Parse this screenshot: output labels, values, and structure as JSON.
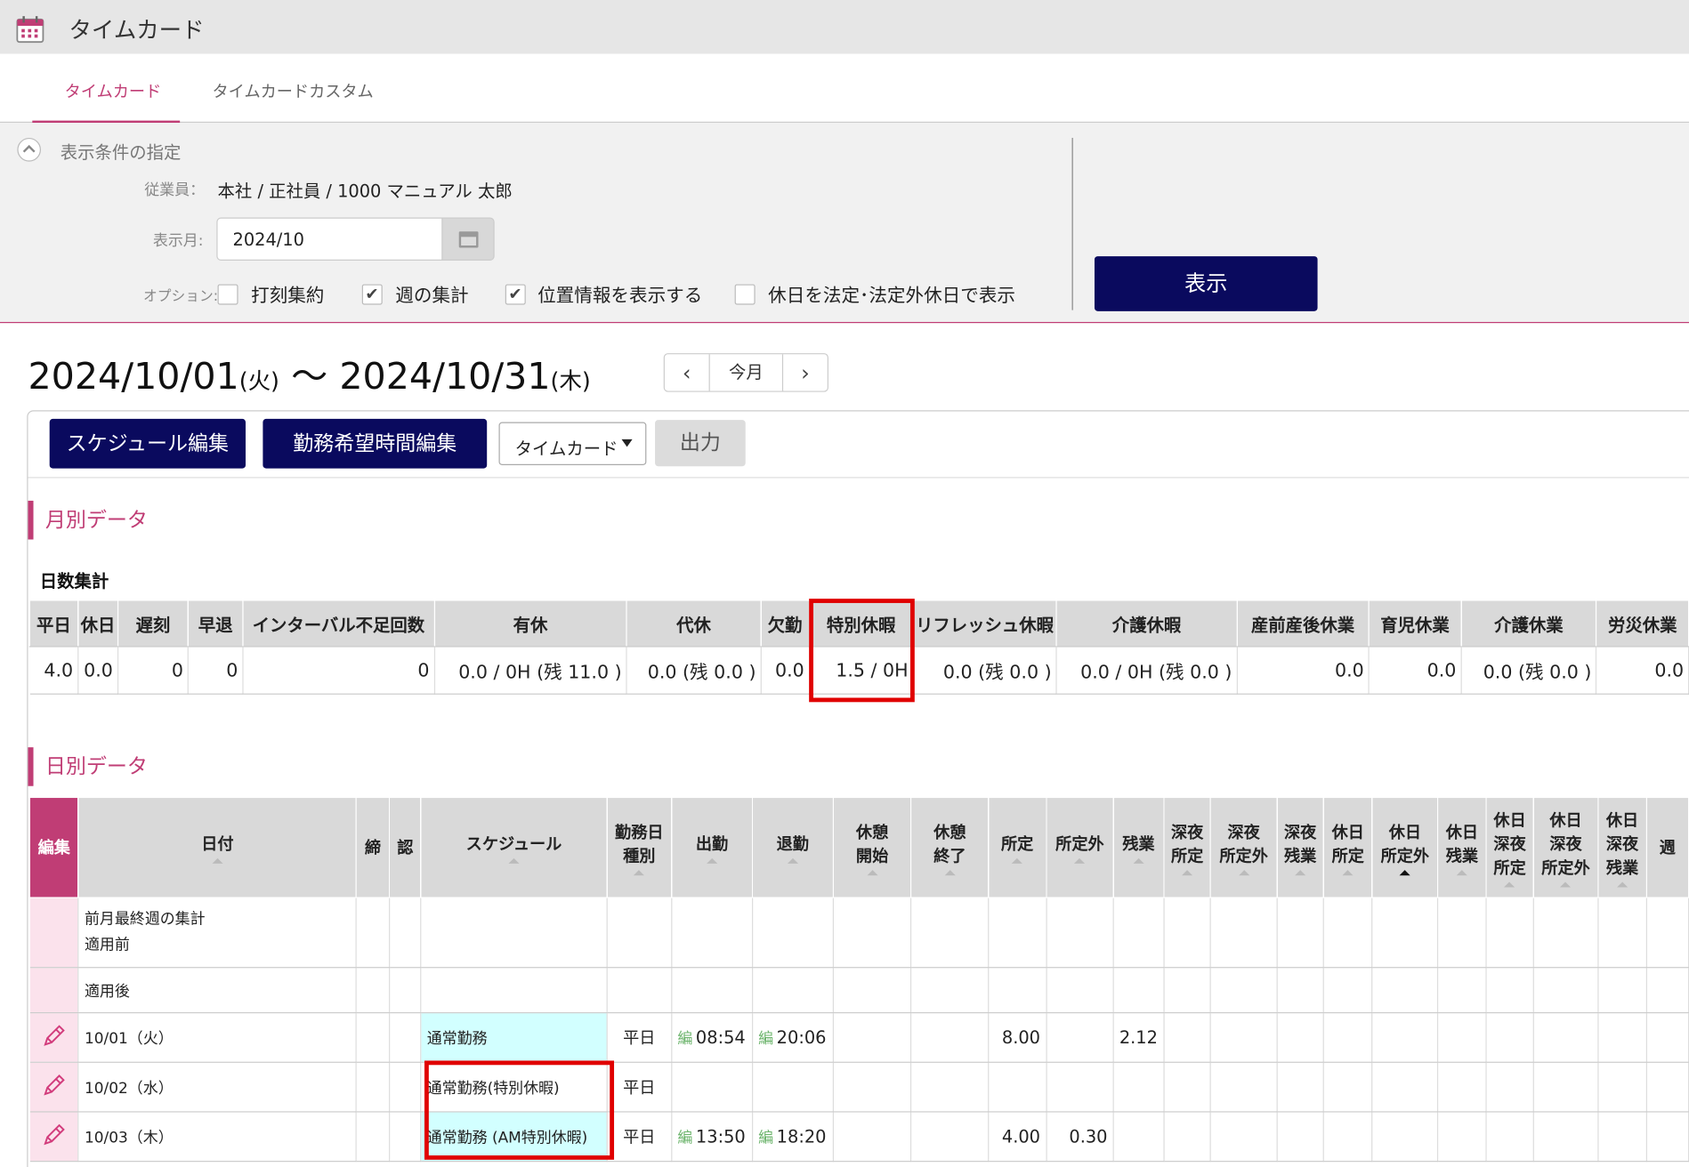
{
  "app": {
    "title": "タイムカード",
    "icon": "calendar-icon"
  },
  "tabs": [
    {
      "label": "タイムカード",
      "active": true
    },
    {
      "label": "タイムカードカスタム",
      "active": false
    }
  ],
  "conditions": {
    "title": "表示条件の指定",
    "employee_label": "従業員：",
    "employee_value": "本社 / 正社員 / 1000 マニュアル 太郎",
    "month_label": "表示月:",
    "month_value": "2024/10",
    "options_label": "オプション:",
    "options": [
      {
        "label": "打刻集約",
        "checked": false
      },
      {
        "label": "週の集計",
        "checked": true
      },
      {
        "label": "位置情報を表示する",
        "checked": true
      },
      {
        "label": "休日を法定･法定外休日で表示",
        "checked": false
      }
    ],
    "show_button": "表示"
  },
  "period": {
    "start": "2024/10/01",
    "start_dow": "(火)",
    "sep": " ～ ",
    "end": "2024/10/31",
    "end_dow": "(木)"
  },
  "nav": {
    "prev": "‹",
    "today": "今月",
    "next": "›"
  },
  "toolbar": {
    "schedule_edit": "スケジュール編集",
    "wish_edit": "勤務希望時間編集",
    "view_select": "タイムカード",
    "output": "出力"
  },
  "monthly": {
    "section": "月別データ",
    "subsection": "日数集計",
    "headers": [
      "平日",
      "休日",
      "遅刻",
      "早退",
      "インターバル不足回数",
      "有休",
      "代休",
      "欠勤",
      "特別休暇",
      "リフレッシュ休暇",
      "介護休暇",
      "産前産後休業",
      "育児休業",
      "介護休業",
      "労災休業"
    ],
    "values": [
      "4.0",
      "0.0",
      "0",
      "0",
      "0",
      "0.0 / 0H (残 11.0 )",
      "0.0 (残 0.0 )",
      "0.0",
      "1.5 / 0H",
      "0.0 (残 0.0 )",
      "0.0 / 0H (残 0.0 )",
      "0.0",
      "0.0",
      "0.0 (残 0.0 )",
      "0.0"
    ]
  },
  "daily": {
    "section": "日別データ",
    "headers": [
      "編集",
      "日付",
      "締",
      "認",
      "スケジュール",
      "勤務日\n種別",
      "出勤",
      "退勤",
      "休憩\n開始",
      "休憩\n終了",
      "所定",
      "所定外",
      "残業",
      "深夜\n所定",
      "深夜\n所定外",
      "深夜\n残業",
      "休日\n所定",
      "休日\n所定外",
      "休日\n残業",
      "休日\n深夜\n所定",
      "休日\n深夜\n所定外",
      "休日\n深夜\n残業",
      "週"
    ],
    "edit_tag": "編",
    "rows": [
      {
        "date": "前月最終週の集計",
        "date2": "適用前",
        "schedule": "",
        "daytype": "",
        "in": "",
        "out": "",
        "shotei": "",
        "shoteigai": "",
        "zangyo": ""
      },
      {
        "date": "適用後",
        "date2": "",
        "schedule": "",
        "daytype": "",
        "in": "",
        "out": "",
        "shotei": "",
        "shoteigai": "",
        "zangyo": ""
      },
      {
        "date": "10/01（火）",
        "date2": "",
        "schedule": "通常勤務",
        "daytype": "平日",
        "in": "08:54",
        "out": "20:06",
        "shotei": "8.00",
        "shoteigai": "",
        "zangyo": "2.12"
      },
      {
        "date": "10/02（水）",
        "date2": "",
        "schedule": "通常勤務(特別休暇)",
        "daytype": "平日",
        "in": "",
        "out": "",
        "shotei": "",
        "shoteigai": "",
        "zangyo": ""
      },
      {
        "date": "10/03（木）",
        "date2": "",
        "schedule": "通常勤務 (AM特別休暇)",
        "daytype": "平日",
        "in": "13:50",
        "out": "18:20",
        "shotei": "4.00",
        "shoteigai": "0.30",
        "zangyo": ""
      }
    ]
  },
  "colors": {
    "accent": "#c03d75",
    "primary_button": "#0a0a5e",
    "highlight": "#e00000",
    "schedule_cell": "#d2ffff"
  }
}
